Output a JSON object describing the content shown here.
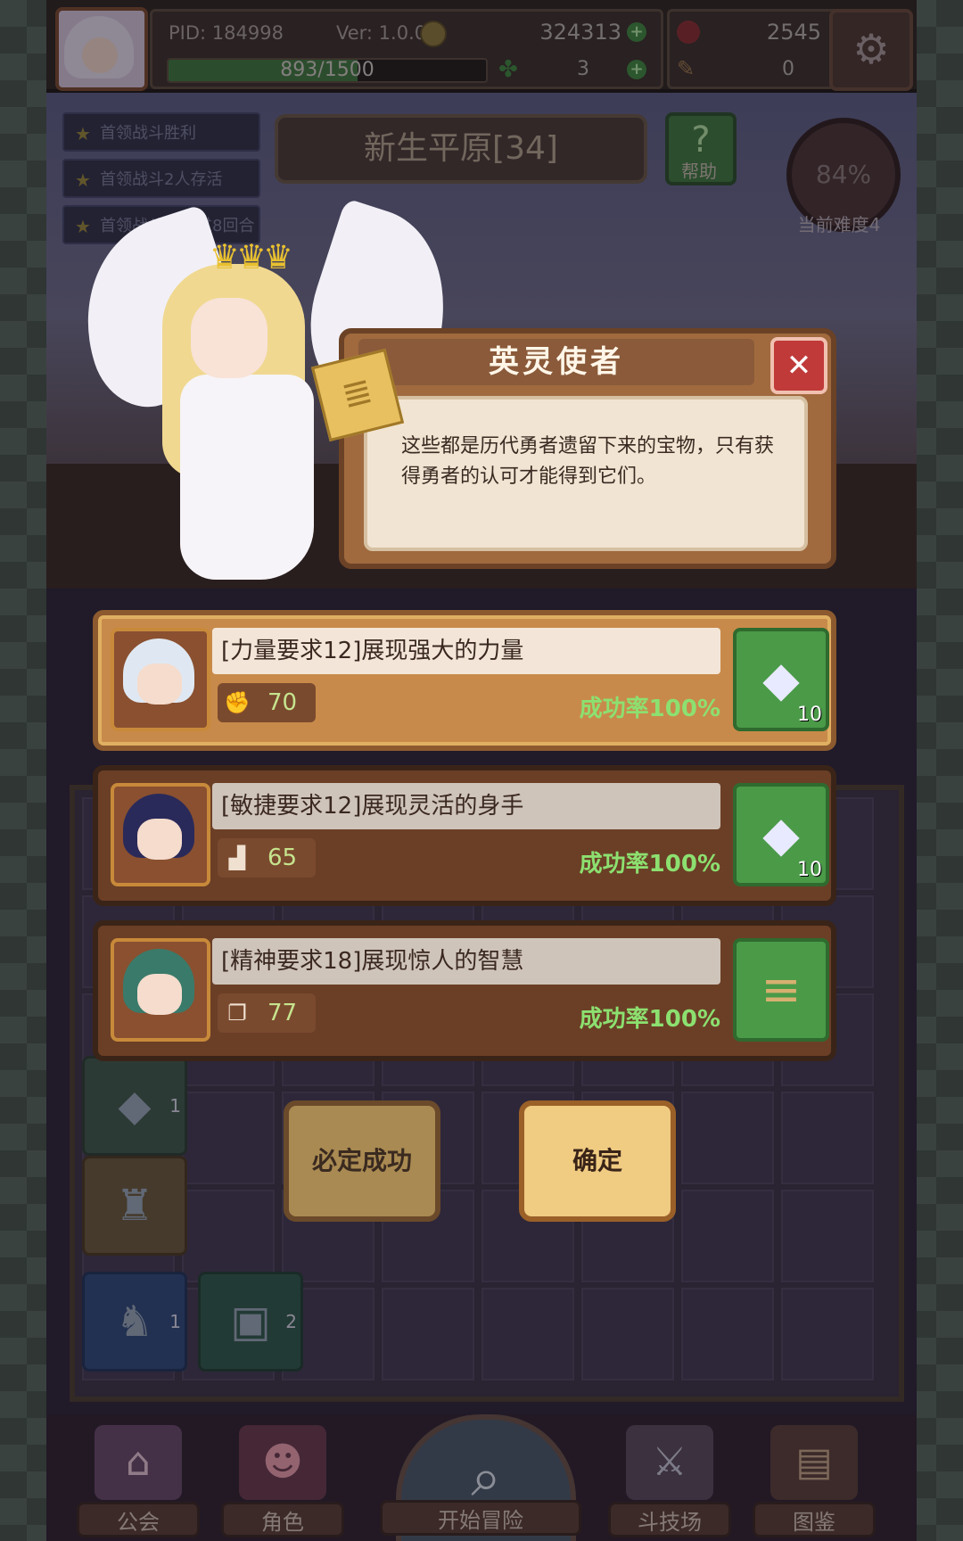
{
  "header": {
    "pid_label": "PID: 184998",
    "version_label": "Ver: 1.0.0.0",
    "gold": "324313",
    "gems": "2545",
    "xp_text": "893/1500",
    "xp_fraction": 0.595,
    "clovers": "3",
    "bones": "0",
    "plus_symbol": "+"
  },
  "missions": [
    {
      "label": "首领战斗胜利"
    },
    {
      "label": "首领战斗2人存活"
    },
    {
      "label": "首领战斗不超过8回合"
    }
  ],
  "zone": {
    "name": "新生平原[34]",
    "help_icon": "?",
    "help_label": "帮助",
    "difficulty_percent": "84%",
    "difficulty_label": "当前难度4"
  },
  "dialog": {
    "title": "英灵使者",
    "close_icon": "✕",
    "text": "这些都是历代勇者遗留下来的宝物，只有获得勇者的认可才能得到它们。"
  },
  "options": [
    {
      "requirement": "[力量要求12]展现强大的力量",
      "stat_icon": "fist-icon",
      "stat_glyph": "✊",
      "stat_value": "70",
      "success_rate": "成功率100%",
      "reward_icon": "crystal-icon",
      "reward_glyph": "◆",
      "reward_count": "10",
      "hair": "#dfe8f2"
    },
    {
      "requirement": "[敏捷要求12]展现灵活的身手",
      "stat_icon": "boot-icon",
      "stat_glyph": "▟",
      "stat_value": "65",
      "success_rate": "成功率100%",
      "reward_icon": "crystal-icon",
      "reward_glyph": "◆",
      "reward_count": "10",
      "hair": "#2a2a5a"
    },
    {
      "requirement": "[精神要求18]展现惊人的智慧",
      "stat_icon": "book-icon",
      "stat_glyph": "❐",
      "stat_value": "77",
      "success_rate": "成功率100%",
      "reward_icon": "scroll-icon",
      "reward_glyph": "≡",
      "reward_count": "",
      "hair": "#3a7a6a"
    }
  ],
  "inventory": [
    {
      "icon": "crystal-icon",
      "glyph": "◆",
      "count": "1",
      "bg": "#3e5a4a"
    },
    {
      "icon": "chest-icon",
      "glyph": "▣",
      "count": "2",
      "bg": "#3e5a4a"
    }
  ],
  "buttons": {
    "guaranteed_success": "必定成功",
    "confirm": "确定"
  },
  "nav": [
    {
      "label": "公会",
      "icon": "guild-icon",
      "glyph": "⌂"
    },
    {
      "label": "角色",
      "icon": "character-icon",
      "glyph": "☻"
    },
    {
      "label": "开始冒险",
      "icon": "adventure-icon",
      "glyph": "⌕"
    },
    {
      "label": "斗技场",
      "icon": "arena-icon",
      "glyph": "⚔"
    },
    {
      "label": "图鉴",
      "icon": "codex-icon",
      "glyph": "▤"
    }
  ],
  "colors": {
    "success_text": "#8ce070",
    "reward_bg": "#4a9a48",
    "close_button": "#c03a3a"
  }
}
